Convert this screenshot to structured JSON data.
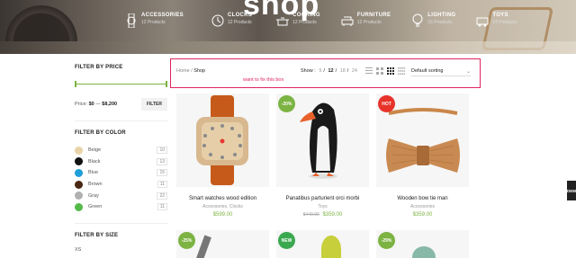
{
  "hero": {
    "title": "shop",
    "categories": [
      {
        "name": "Accessories",
        "count": "12 Products",
        "icon": "watch-icon"
      },
      {
        "name": "Clocks",
        "count": "12 Products",
        "icon": "clock-icon"
      },
      {
        "name": "Cooking",
        "count": "12 Products",
        "icon": "pot-icon"
      },
      {
        "name": "Furniture",
        "count": "12 Products",
        "icon": "sofa-icon"
      },
      {
        "name": "Lighting",
        "count": "16 Products",
        "icon": "bulb-icon"
      },
      {
        "name": "Toys",
        "count": "14 Products",
        "icon": "train-icon"
      }
    ]
  },
  "sidebar": {
    "price": {
      "title": "FILTER BY PRICE",
      "label": "Price:",
      "min": "$0",
      "sep": "—",
      "max": "$8,200",
      "button": "FILTER",
      "range_low": 0.0,
      "range_high": 1.0
    },
    "color": {
      "title": "FILTER BY COLOR",
      "items": [
        {
          "name": "Beige",
          "count": "10",
          "swatch": "#e8d4a8"
        },
        {
          "name": "Black",
          "count": "13",
          "swatch": "#111111"
        },
        {
          "name": "Blue",
          "count": "15",
          "swatch": "#1e9fd8"
        },
        {
          "name": "Brown",
          "count": "11",
          "swatch": "#4a2712"
        },
        {
          "name": "Gray",
          "count": "22",
          "swatch": "#b0b0b0"
        },
        {
          "name": "Green",
          "count": "11",
          "swatch": "#54b948"
        }
      ]
    },
    "size": {
      "title": "FILTER BY SIZE",
      "first": "XS"
    }
  },
  "toolbar": {
    "breadcrumb_home": "Home",
    "breadcrumb_sep": "/",
    "breadcrumb_current": "Shop",
    "note": "want to fix this box",
    "show_label": "Show :",
    "show_options": [
      "9",
      "12",
      "18",
      "24"
    ],
    "show_active": "12",
    "sort_value": "Default sorting",
    "view_icons": [
      "list-view-icon",
      "grid-2-icon",
      "grid-3-icon",
      "grid-4-icon"
    ]
  },
  "products": [
    {
      "name": "Smart watches wood edition",
      "category": "Accessories, Clocks",
      "price": "$599.00",
      "old_price": "",
      "badge": ""
    },
    {
      "name": "Panatibus parturient orci morbi",
      "category": "Toys",
      "price": "$359.00",
      "old_price": "$449.00",
      "badge": "-20%",
      "badge_color": "#7cb342"
    },
    {
      "name": "Wooden bow tie man",
      "category": "Accessories",
      "price": "$359.00",
      "old_price": "",
      "badge": "HOT",
      "badge_color": "#e8332a"
    }
  ],
  "next_row_badges": [
    {
      "text": "-25%",
      "color": "#7cb342"
    },
    {
      "text": "NEW",
      "color": "#3aa84f"
    },
    {
      "text": "-29%",
      "color": "#7cb342"
    }
  ],
  "side_tab": "DEM",
  "accent": "#7cb342",
  "highlight": "#e0245e"
}
